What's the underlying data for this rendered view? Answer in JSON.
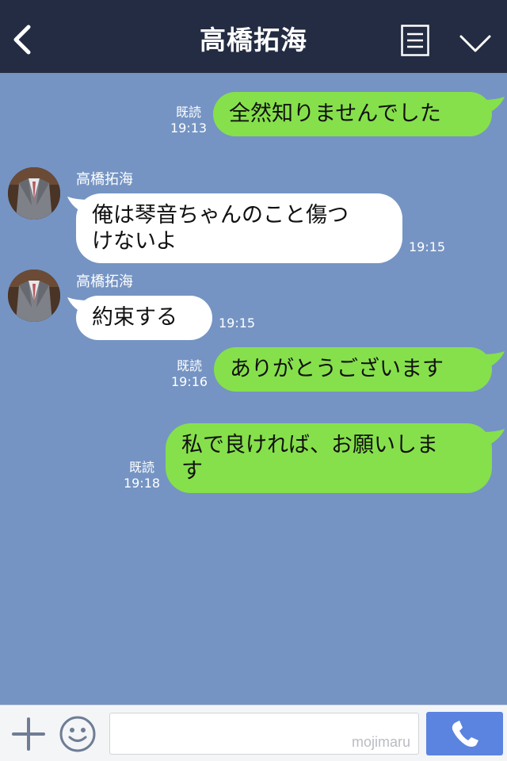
{
  "header": {
    "title": "高橋拓海",
    "back_icon": "chevron-left-icon",
    "menu_icon": "list-icon",
    "collapse_icon": "chevron-down-icon",
    "background": "#232c42"
  },
  "chat": {
    "background": "#7594c3",
    "messages": [
      {
        "side": "right",
        "read": "既読",
        "time": "19:13",
        "lines": [
          "全然知りませんでした"
        ]
      },
      {
        "side": "left",
        "sender": "高橋拓海",
        "time": "19:15",
        "lines": [
          "俺は琴音ちゃんのこと傷つ",
          "けないよ"
        ]
      },
      {
        "side": "left",
        "sender": "高橋拓海",
        "time": "19:15",
        "lines": [
          "約束する"
        ]
      },
      {
        "side": "right",
        "read": "既読",
        "time": "19:16",
        "lines": [
          "ありがとうございます"
        ]
      },
      {
        "side": "right",
        "read": "既読",
        "time": "19:18",
        "lines": [
          "私で良ければ、お願いしま",
          "す"
        ]
      }
    ]
  },
  "footer": {
    "plus_icon": "plus-icon",
    "emoji_icon": "smiley-icon",
    "call_icon": "phone-icon",
    "input_value": "",
    "watermark": "mojimaru"
  },
  "colors": {
    "outgoing_bubble": "#86e04b",
    "incoming_bubble": "#ffffff",
    "call_button": "#5a84df"
  }
}
